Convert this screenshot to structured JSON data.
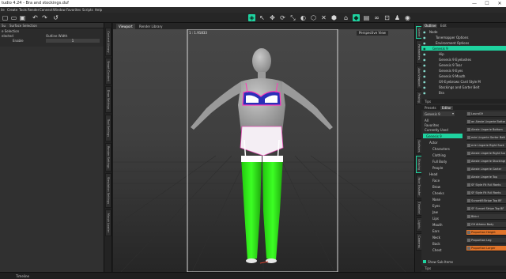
{
  "window": {
    "title": "tudio 4.24 - Bra and stockings.duf",
    "minimize": "—",
    "maximize": "☐",
    "close": "✕"
  },
  "menu": [
    "Create",
    "Tools",
    "Render",
    "Connect",
    "Window",
    "Favorites",
    "Scripts",
    "Help"
  ],
  "menu_prefix": "ile",
  "left_panel": {
    "header": {
      "tab1": "Surface Selection",
      "tab2": "Su"
    },
    "row1_label": "e Selection",
    "row2_left": "elected",
    "row2_right": "Outline Width",
    "row3_value": "Enable",
    "row3_number": "1"
  },
  "left_tabs": [
    "Content Library",
    "Smart Content",
    "Draw Settings",
    "Tool Settings",
    "Render Settings",
    "Simulation Settings",
    "Morph Loader"
  ],
  "viewport": {
    "tabs": [
      "Viewport",
      "Render Library"
    ],
    "label": "1 : 1.91833",
    "camera": "Perspective View"
  },
  "right_tabs": [
    "Scene",
    "Parameters",
    "Aux Viewport",
    "Posing",
    "Surfaces",
    "Shaping",
    "Face Transfer",
    "Timeline",
    "Lights",
    "Cameras"
  ],
  "scene": {
    "tabs": [
      "Outline",
      "Edit"
    ],
    "items": [
      {
        "label": "Node",
        "indent": 0,
        "selected": false
      },
      {
        "label": "Tonemapper Options",
        "indent": 2,
        "selected": false
      },
      {
        "label": "Environment Options",
        "indent": 2,
        "selected": false
      },
      {
        "label": "Genesis 9",
        "indent": 1,
        "selected": true
      },
      {
        "label": "Hip",
        "indent": 3,
        "selected": false
      },
      {
        "label": "Genesis 9 Eyelashes",
        "indent": 3,
        "selected": false
      },
      {
        "label": "Genesis 9 Tear",
        "indent": 3,
        "selected": false
      },
      {
        "label": "Genesis 9 Eyes",
        "indent": 3,
        "selected": false
      },
      {
        "label": "Genesis 9 Mouth",
        "indent": 3,
        "selected": false
      },
      {
        "label": "G9 Eyebrows Card Style M",
        "indent": 3,
        "selected": false
      },
      {
        "label": "Stockings and Garter Belt",
        "indent": 3,
        "selected": false
      },
      {
        "label": "Bra",
        "indent": 3,
        "selected": false
      }
    ],
    "tips": "Tips"
  },
  "shaping": {
    "tabs": [
      "Presets",
      "Editor"
    ],
    "dropdown": "Genesis 9",
    "filters": [
      "All",
      "Favorites",
      "Currently Used"
    ],
    "categories": [
      {
        "label": "Genesis 9",
        "indent": 1,
        "selected": true
      },
      {
        "label": "Actor",
        "indent": 2,
        "selected": false
      },
      {
        "label": "Characters",
        "indent": 3,
        "selected": false
      },
      {
        "label": "Clothing",
        "indent": 3,
        "selected": false
      },
      {
        "label": "Full Body",
        "indent": 3,
        "selected": false
      },
      {
        "label": "People",
        "indent": 3,
        "selected": false
      },
      {
        "label": "Head",
        "indent": 2,
        "selected": false
      },
      {
        "label": "Face",
        "indent": 3,
        "selected": false
      },
      {
        "label": "Brow",
        "indent": 3,
        "selected": false
      },
      {
        "label": "Cheeks",
        "indent": 3,
        "selected": false
      },
      {
        "label": "Nose",
        "indent": 3,
        "selected": false
      },
      {
        "label": "Eyes",
        "indent": 3,
        "selected": false
      },
      {
        "label": "Jaw",
        "indent": 3,
        "selected": false
      },
      {
        "label": "Lips",
        "indent": 3,
        "selected": false
      },
      {
        "label": "Mouth",
        "indent": 3,
        "selected": false
      },
      {
        "label": "Ears",
        "indent": 3,
        "selected": false
      },
      {
        "label": "Neck",
        "indent": 3,
        "selected": false
      },
      {
        "label": "Back",
        "indent": 3,
        "selected": false
      },
      {
        "label": "Chest",
        "indent": 3,
        "selected": false
      }
    ],
    "props": [
      {
        "label": "LauraG9",
        "hl": false
      },
      {
        "label": "an Alexie Lingerie Bottom",
        "hl": false
      },
      {
        "label": "Alexie Lingerie Bottom",
        "hl": false
      },
      {
        "label": "exie Lingerie Garter Belt",
        "hl": false
      },
      {
        "label": "erie Lingerie Right Sock",
        "hl": false
      },
      {
        "label": "Alexie Lingerie Right Sock",
        "hl": false
      },
      {
        "label": "Alexie Lingerie Stockings",
        "hl": false
      },
      {
        "label": "Alexie Lingerie Garter",
        "hl": false
      },
      {
        "label": "Alexie Lingerie Top",
        "hl": false
      },
      {
        "label": "SF Style Fit Full Rants",
        "hl": false
      },
      {
        "label": "SF Style Fit Full Rants",
        "hl": false
      },
      {
        "label": "Sunsett5Stripe Top BF",
        "hl": false
      },
      {
        "label": "SF Sunset Stripe Top BF",
        "hl": false
      },
      {
        "label": "Bikini",
        "hl": false
      },
      {
        "label": "G9 Athena Body",
        "hl": false
      },
      {
        "label": "Proportion Height",
        "hl": true
      },
      {
        "label": "Proportion Leg",
        "hl": false
      },
      {
        "label": "Proportion Larger",
        "hl": true
      }
    ],
    "show_sub_items": "Show Sub Items",
    "tips": "Tips"
  },
  "status": {
    "item1": "Timeline"
  },
  "colors": {
    "accent": "#1fd3a0",
    "highlight": "#e0742a",
    "stockings": "#33f21a"
  }
}
